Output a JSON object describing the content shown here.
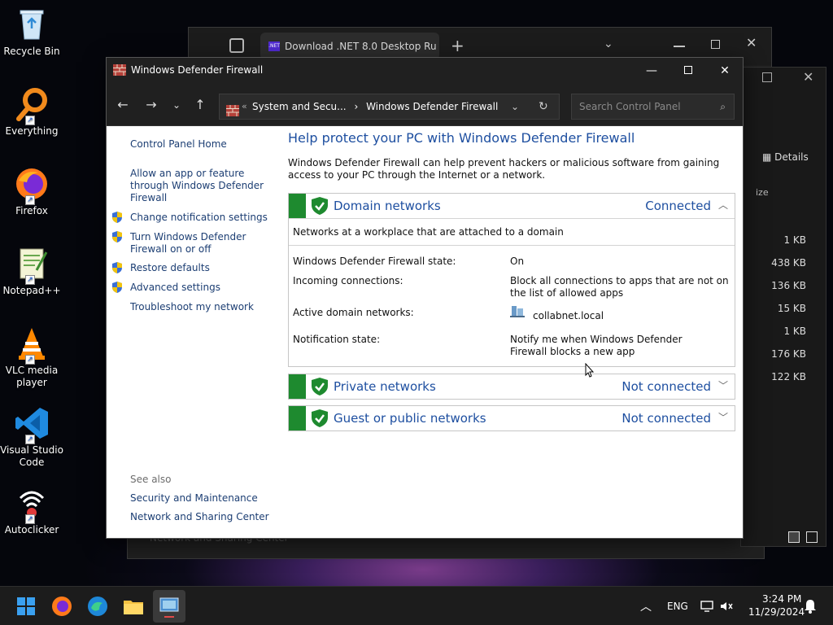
{
  "desktop": {
    "icons": [
      {
        "label": "Recycle Bin"
      },
      {
        "label": "Everything"
      },
      {
        "label": "Firefox"
      },
      {
        "label": "Notepad++"
      },
      {
        "label": "VLC media player"
      },
      {
        "label": "Visual Studio Code"
      },
      {
        "label": "Autoclicker"
      }
    ]
  },
  "background_browser": {
    "tab_title": "Download .NET 8.0 Desktop Ru",
    "tab_icon_text": ".NET"
  },
  "background_explorer": {
    "details_label": "Details",
    "size_header": "ize",
    "sizes": [
      "1 KB",
      "438 KB",
      "136 KB",
      "15 KB",
      "1 KB",
      "176 KB",
      "122 KB"
    ],
    "obscured_link": "Network and Sharing Center"
  },
  "window": {
    "title": "Windows Defender Firewall",
    "breadcrumb_prefix": "«",
    "breadcrumb_parent": "System and Secu...",
    "breadcrumb_sep": "›",
    "breadcrumb_current": "Windows Defender Firewall",
    "search_placeholder": "Search Control Panel"
  },
  "left_pane": {
    "home": "Control Panel Home",
    "allow_app": "Allow an app or feature through Windows Defender Firewall",
    "change_notifications": "Change notification settings",
    "turn_on_off": "Turn Windows Defender Firewall on or off",
    "restore_defaults": "Restore defaults",
    "advanced_settings": "Advanced settings",
    "troubleshoot": "Troubleshoot my network",
    "see_also": "See also",
    "security_maintenance": "Security and Maintenance",
    "network_sharing": "Network and Sharing Center"
  },
  "main": {
    "heading": "Help protect your PC with Windows Defender Firewall",
    "intro": "Windows Defender Firewall can help prevent hackers or malicious software from gaining access to your PC through the Internet or a network.",
    "domain": {
      "title": "Domain networks",
      "status": "Connected",
      "description": "Networks at a workplace that are attached to a domain",
      "state_label": "Windows Defender Firewall state:",
      "state_value": "On",
      "incoming_label": "Incoming connections:",
      "incoming_value": "Block all connections to apps that are not on the list of allowed apps",
      "active_label": "Active domain networks:",
      "active_value": "collabnet.local",
      "notification_label": "Notification state:",
      "notification_value": "Notify me when Windows Defender Firewall blocks a new app"
    },
    "private": {
      "title": "Private networks",
      "status": "Not connected"
    },
    "public": {
      "title": "Guest or public networks",
      "status": "Not connected"
    }
  },
  "taskbar": {
    "language": "ENG",
    "time": "3:24 PM",
    "date": "11/29/2024"
  },
  "colors": {
    "accent_green": "#1e8a2f",
    "link_blue": "#1e4fa0",
    "taskbar": "#1c1c1c"
  }
}
